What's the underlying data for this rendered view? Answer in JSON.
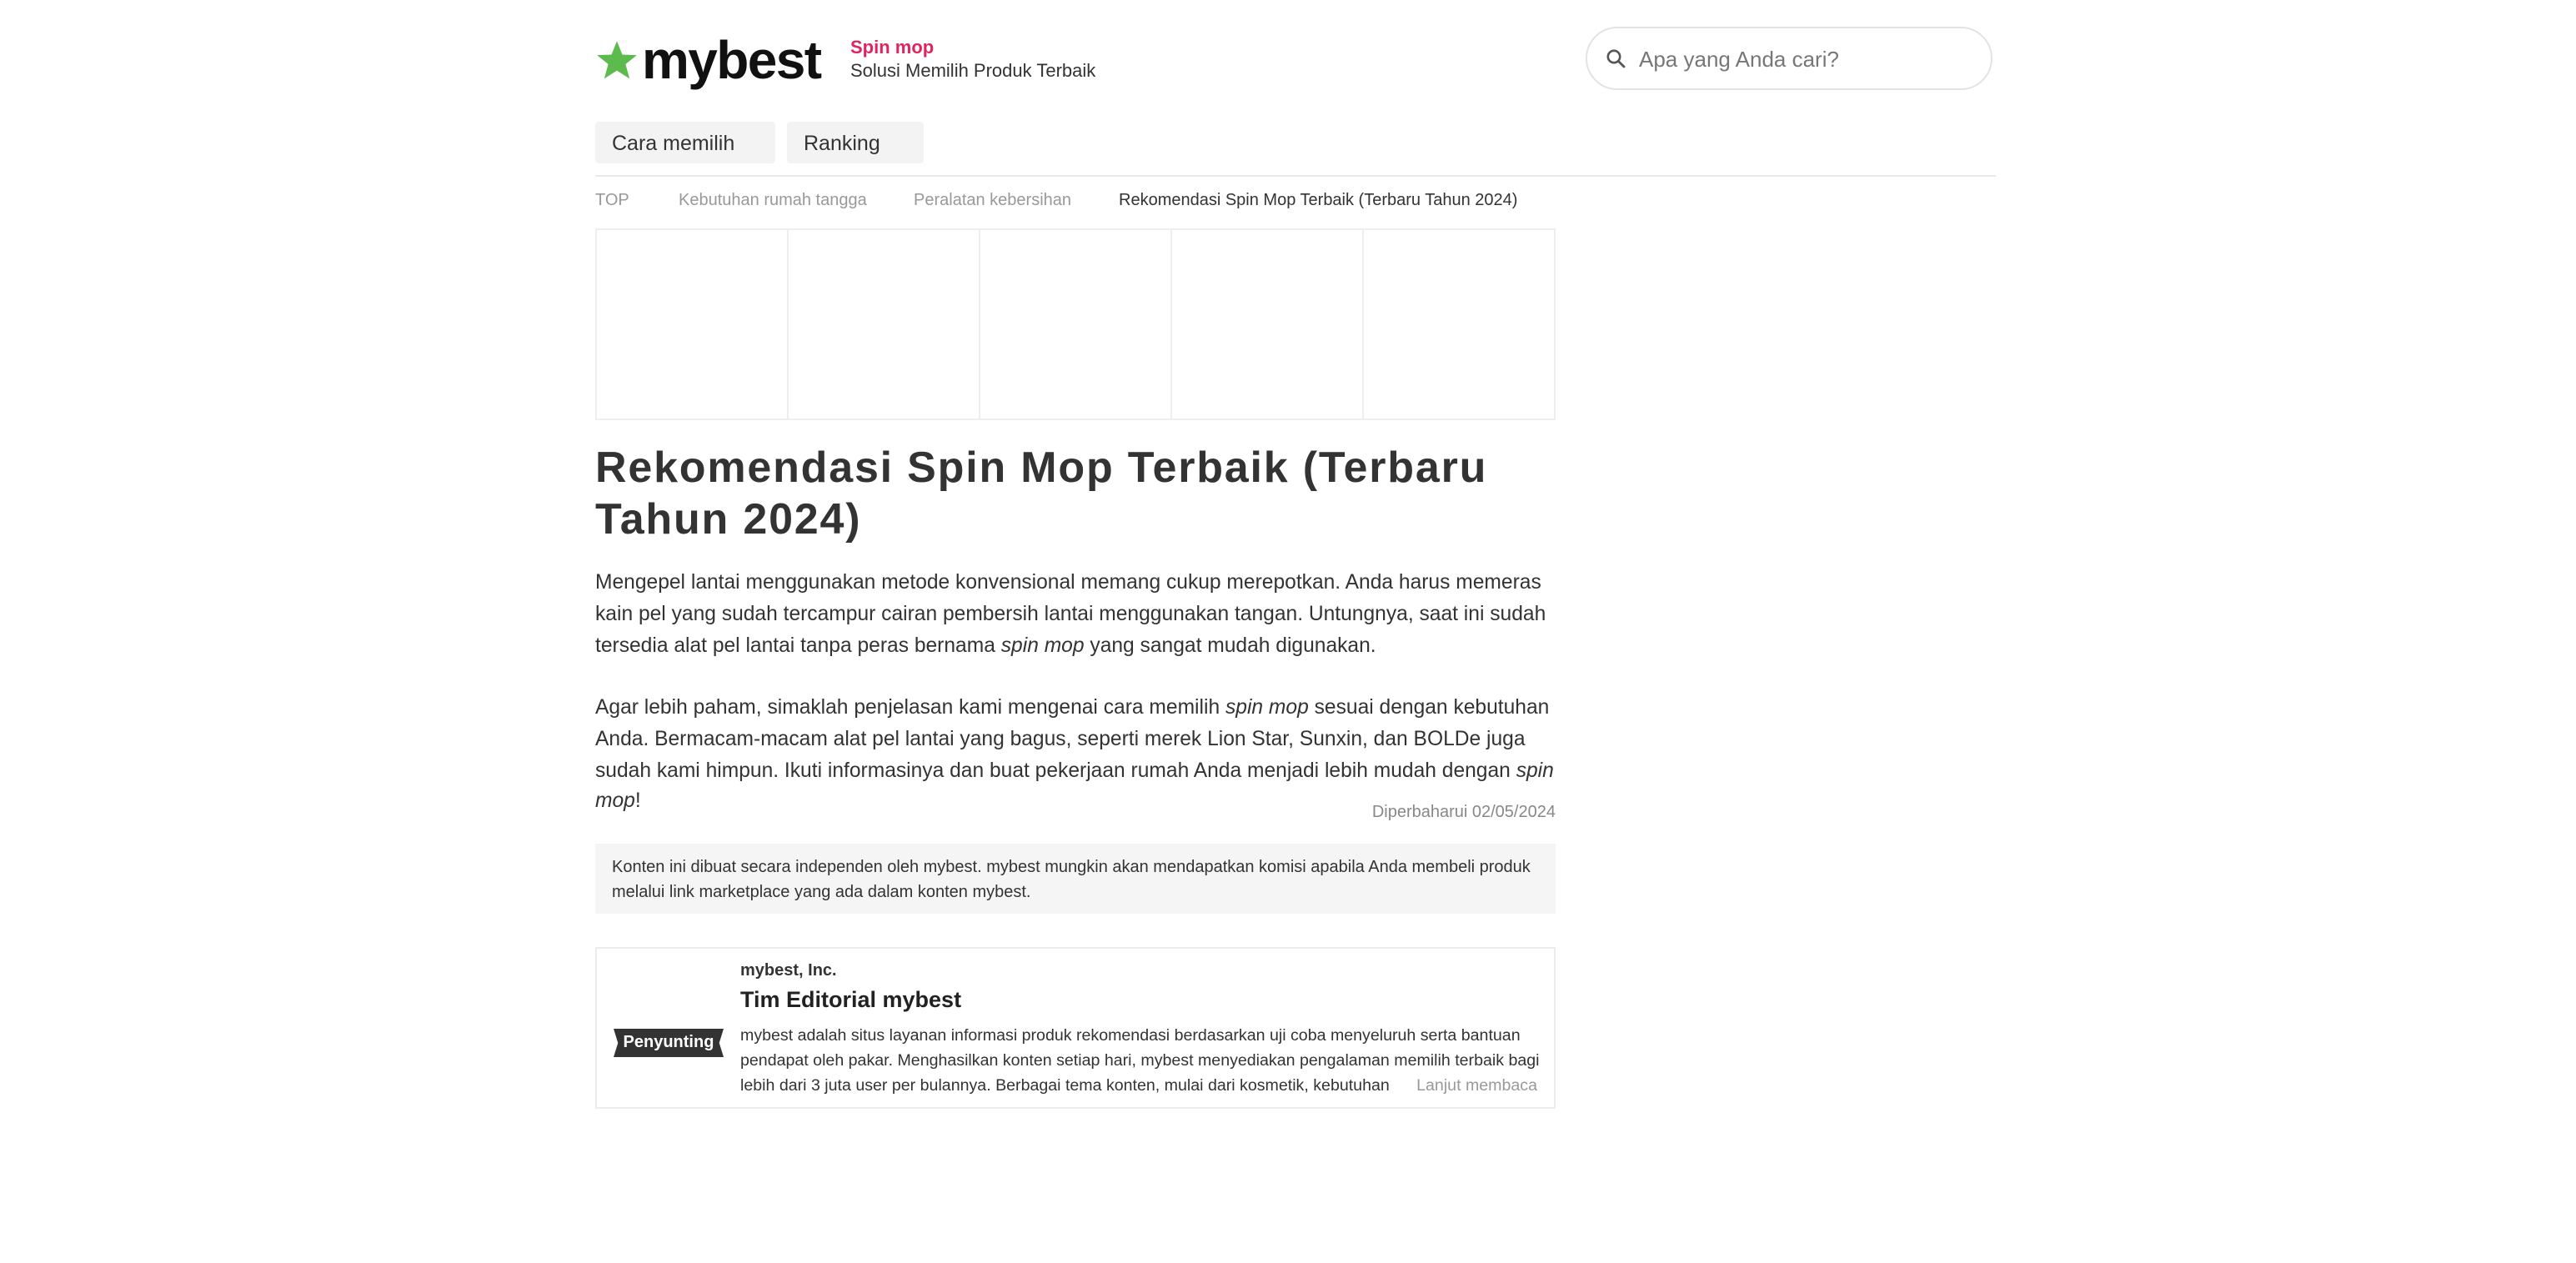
{
  "site": {
    "logo_text": "mybest",
    "category": "Spin mop",
    "slogan": "Solusi Memilih Produk Terbaik",
    "brand_star_color": "#5dba4d",
    "accent_color": "#e0245e"
  },
  "search": {
    "placeholder": "Apa yang Anda cari?",
    "icon": "search-icon"
  },
  "tabs": [
    {
      "label": "Cara memilih"
    },
    {
      "label": "Ranking"
    }
  ],
  "breadcrumb": [
    {
      "label": "TOP"
    },
    {
      "label": "Kebutuhan rumah tangga"
    },
    {
      "label": "Peralatan kebersihan"
    },
    {
      "label": "Rekomendasi Spin Mop Terbaik (Terbaru Tahun 2024)"
    }
  ],
  "article": {
    "title": "Rekomendasi Spin Mop Terbaik (Terbaru Tahun 2024)",
    "intro_p1_a": "Mengepel lantai menggunakan metode konvensional memang cukup merepotkan. Anda harus memeras kain pel yang sudah tercampur cairan pembersih lantai menggunakan tangan. Untungnya, saat ini sudah tersedia alat pel lantai tanpa peras bernama ",
    "intro_p1_em": "spin mop",
    "intro_p1_b": " yang sangat mudah digunakan.",
    "intro_p2_a": "Agar lebih paham, simaklah penjelasan kami mengenai cara memilih ",
    "intro_p2_em1": "spin mop",
    "intro_p2_b": " sesuai dengan kebutuhan Anda. Bermacam-macam alat pel lantai yang bagus, seperti merek Lion Star, Sunxin, dan BOLDe juga sudah kami himpun. Ikuti informasinya dan buat pekerjaan rumah Anda menjadi lebih mudah dengan ",
    "intro_p2_em2": "spin mop",
    "intro_p2_c": "!",
    "updated": "Diperbaharui 02/05/2024",
    "disclaimer": "Konten ini dibuat secara independen oleh mybest. mybest mungkin akan mendapatkan komisi apabila Anda membeli produk melalui link marketplace yang ada dalam konten mybest."
  },
  "editor": {
    "badge": "Penyunting",
    "company": "mybest, Inc.",
    "name": "Tim Editorial mybest",
    "description": "mybest adalah situs layanan informasi produk rekomendasi berdasarkan uji coba menyeluruh serta bantuan pendapat oleh pakar. Menghasilkan konten setiap hari, mybest menyediakan pengalaman memilih terbaik bagi lebih dari 3 juta user per bulannya. Berbagai tema konten, mulai dari kosmetik, kebutuhan",
    "read_more": "Lanjut membaca"
  }
}
